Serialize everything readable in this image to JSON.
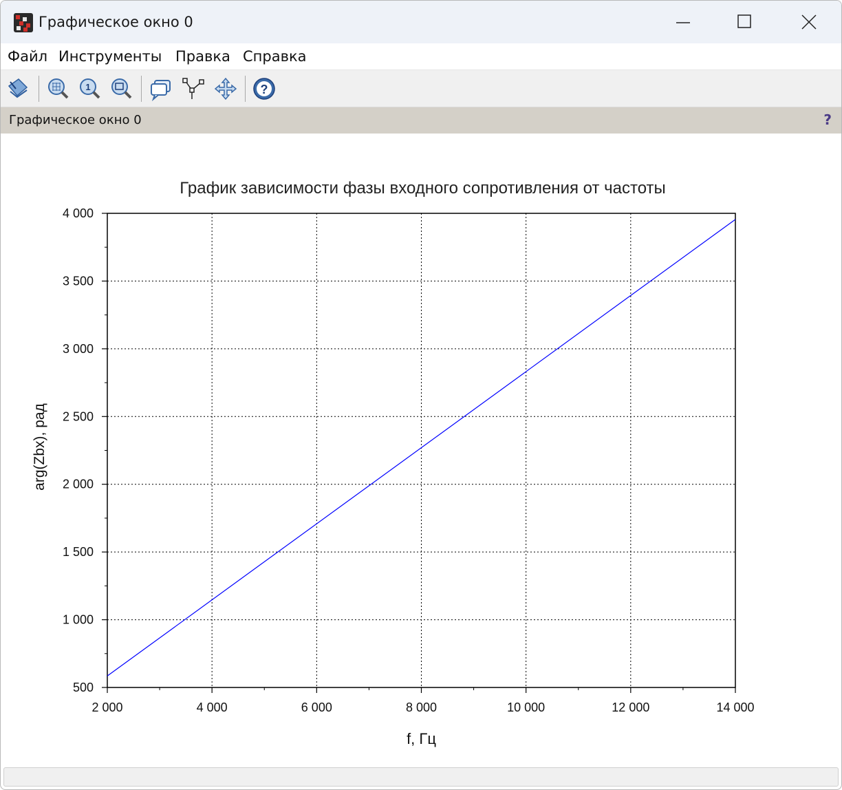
{
  "window": {
    "title": "Графическое окно 0"
  },
  "menu": {
    "items": [
      "Файл",
      "Инструменты",
      "Правка",
      "Справка"
    ]
  },
  "toolbar": {
    "icons": [
      "rotate-icon",
      "zoom-in-icon",
      "zoom-original-icon",
      "zoom-select-icon",
      "datatip-icon",
      "edit-curve-icon",
      "pan-icon",
      "help-icon"
    ]
  },
  "dock": {
    "title": "Графическое окно 0",
    "help": "?"
  },
  "colors": {
    "line": "#0000ff",
    "titlebar": "#eef2f8",
    "dockbar": "#d4d0c8"
  },
  "chart_data": {
    "type": "line",
    "title": "График зависимости фазы входного сопротивления от частоты",
    "xlabel": "f, Гц",
    "ylabel": "arg(Zbx), рад",
    "xlim": [
      2000,
      14000
    ],
    "ylim": [
      500,
      4000
    ],
    "xticks": [
      "2 000",
      "4 000",
      "6 000",
      "8 000",
      "10 000",
      "12 000",
      "14 000"
    ],
    "yticks": [
      "500",
      "1 000",
      "1 500",
      "2 000",
      "2 500",
      "3 000",
      "3 500",
      "4 000"
    ],
    "grid": true,
    "series": [
      {
        "x": [
          2000,
          14000
        ],
        "y": [
          585,
          3955
        ]
      }
    ]
  }
}
